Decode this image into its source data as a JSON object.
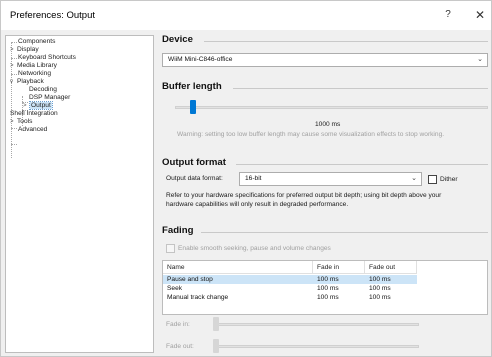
{
  "window": {
    "title": "Preferences: Output",
    "help_label": "?",
    "close_label": "✕"
  },
  "tree": {
    "items": [
      {
        "label": "Components",
        "expander": ""
      },
      {
        "label": "Display",
        "expander": ">"
      },
      {
        "label": "Keyboard Shortcuts",
        "expander": ""
      },
      {
        "label": "Media Library",
        "expander": ">"
      },
      {
        "label": "Networking",
        "expander": ""
      },
      {
        "label": "Playback",
        "expander": "v"
      },
      {
        "label": "Decoding",
        "expander": ""
      },
      {
        "label": "DSP Manager",
        "expander": ""
      },
      {
        "label": "Output",
        "expander": ">"
      },
      {
        "label": "Shell Integration",
        "expander": ""
      },
      {
        "label": "Tools",
        "expander": ">"
      },
      {
        "label": "Advanced",
        "expander": ""
      }
    ]
  },
  "device": {
    "heading": "Device",
    "selected": "WiiM Mini-C846-office",
    "arrow": "⌄"
  },
  "buffer": {
    "heading": "Buffer length",
    "value_label": "1000 ms",
    "value_fraction": 0.05,
    "warning": "Warning: setting too low buffer length may cause some visualization effects to stop working."
  },
  "output_format": {
    "heading": "Output format",
    "format_label": "Output data format:",
    "format_value": "16-bit",
    "arrow": "⌄",
    "dither_label": "Dither",
    "dither_checked": false,
    "info_line1": "Refer to your hardware specifications for preferred output bit depth; using bit depth above your",
    "info_line2": "hardware capabilities will only result in degraded performance."
  },
  "fading": {
    "heading": "Fading",
    "enable_label": "Enable smooth seeking, pause and volume changes",
    "enable_checked": false,
    "columns": [
      "Name",
      "Fade in",
      "Fade out"
    ],
    "rows": [
      {
        "name": "Pause and stop",
        "fade_in": "100 ms",
        "fade_out": "100 ms",
        "selected": true
      },
      {
        "name": "Seek",
        "fade_in": "100 ms",
        "fade_out": "100 ms",
        "selected": false
      },
      {
        "name": "Manual track change",
        "fade_in": "100 ms",
        "fade_out": "100 ms",
        "selected": false
      }
    ],
    "fade_in_label": "Fade in:",
    "fade_out_label": "Fade out:"
  }
}
